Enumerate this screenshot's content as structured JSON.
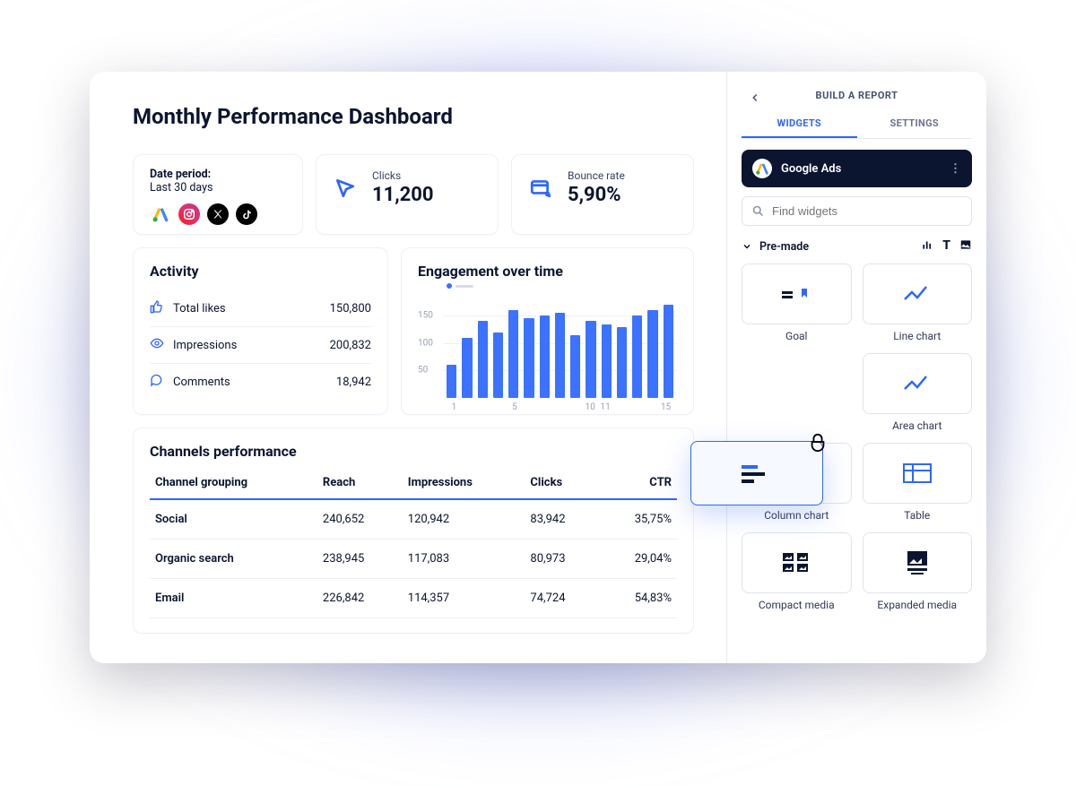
{
  "title": "Monthly Performance Dashboard",
  "period": {
    "label": "Date period:",
    "value": "Last 30 days"
  },
  "brands": [
    "google-ads",
    "instagram",
    "x",
    "tiktok"
  ],
  "kpi": {
    "clicks": {
      "label": "Clicks",
      "value": "11,200"
    },
    "bounce": {
      "label": "Bounce rate",
      "value": "5,90%"
    }
  },
  "activity": {
    "title": "Activity",
    "rows": [
      {
        "label": "Total likes",
        "value": "150,800"
      },
      {
        "label": "Impressions",
        "value": "200,832"
      },
      {
        "label": "Comments",
        "value": "18,942"
      }
    ]
  },
  "engagement_title": "Engagement over time",
  "channels": {
    "title": "Channels performance",
    "headers": [
      "Channel grouping",
      "Reach",
      "Impressions",
      "Clicks",
      "CTR"
    ],
    "rows": [
      [
        "Social",
        "240,652",
        "120,942",
        "83,942",
        "35,75%"
      ],
      [
        "Organic search",
        "238,945",
        "117,083",
        "80,973",
        "29,04%"
      ],
      [
        "Email",
        "226,842",
        "114,357",
        "74,724",
        "54,83%"
      ]
    ]
  },
  "sidepanel": {
    "title": "BUILD A REPORT",
    "tabs": {
      "widgets": "WIDGETS",
      "settings": "SETTINGS"
    },
    "source": "Google Ads",
    "search_placeholder": "Find widgets",
    "group": "Pre-made",
    "widgets": [
      "Goal",
      "Line chart",
      "",
      "Area chart",
      "Column chart",
      "Table",
      "Compact media",
      "Expanded media"
    ]
  },
  "chart_data": {
    "type": "bar",
    "title": "Engagement over time",
    "xlabel": "",
    "ylabel": "",
    "y_ticks": [
      50,
      100,
      150
    ],
    "x_ticks": [
      1,
      5,
      10,
      11,
      15
    ],
    "ylim": [
      0,
      180
    ],
    "categories": [
      1,
      2,
      3,
      4,
      5,
      6,
      7,
      8,
      9,
      10,
      11,
      12,
      13,
      14,
      15
    ],
    "values": [
      60,
      110,
      140,
      120,
      160,
      145,
      150,
      155,
      115,
      140,
      135,
      130,
      150,
      160,
      170
    ]
  }
}
